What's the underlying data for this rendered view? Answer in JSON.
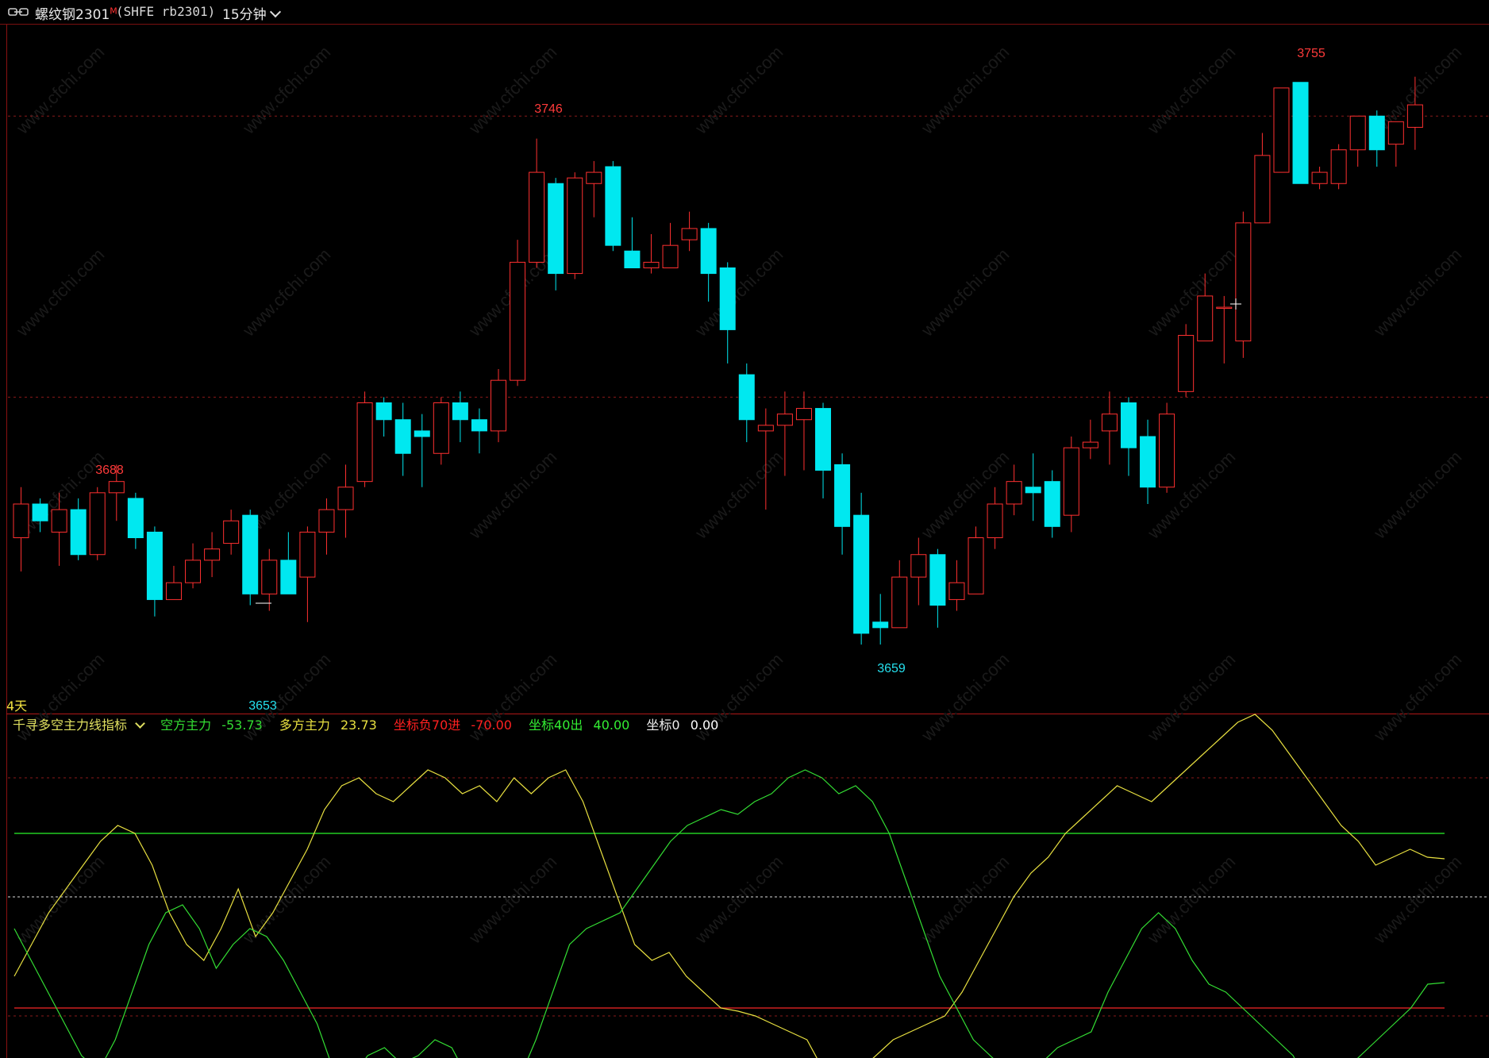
{
  "header": {
    "title": "螺纹钢2301",
    "superscript": "M",
    "code": "(SHFE rb2301)",
    "period": "15分钟"
  },
  "price_labels": {
    "high1": "3688",
    "high2": "3746",
    "high3": "3755",
    "low1": "3653",
    "low2": "3659"
  },
  "days_label": "4天",
  "indicator": {
    "name": "千寻多空主力线指标",
    "items": [
      {
        "label": "空方主力",
        "value": "-53.73",
        "color": "#33dd33"
      },
      {
        "label": "多方主力",
        "value": "23.73",
        "color": "#e8e040"
      },
      {
        "label": "坐标负70进",
        "value": "-70.00",
        "color": "#ff2020"
      },
      {
        "label": "坐标40出",
        "value": "40.00",
        "color": "#33ee33"
      },
      {
        "label": "坐标0",
        "value": "0.00",
        "color": "#ffffff"
      }
    ]
  },
  "watermark": "www.cfchi.com",
  "colors": {
    "up": "#ff3030",
    "down": "#00e8f0",
    "bull_line": "#e8e040",
    "bear_line": "#33dd33"
  },
  "chart_data": [
    {
      "type": "candlestick",
      "ylim": [
        3645,
        3765
      ],
      "candles": [
        [
          3675,
          3681,
          3669,
          3684
        ],
        [
          3681,
          3678,
          3676,
          3682
        ],
        [
          3676,
          3680,
          3670,
          3683
        ],
        [
          3680,
          3672,
          3671,
          3682
        ],
        [
          3672,
          3683,
          3671,
          3684
        ],
        [
          3683,
          3685,
          3678,
          3688
        ],
        [
          3682,
          3675,
          3673,
          3683
        ],
        [
          3676,
          3664,
          3661,
          3677
        ],
        [
          3664,
          3667,
          3664,
          3670
        ],
        [
          3667,
          3671,
          3666,
          3674
        ],
        [
          3671,
          3673,
          3668,
          3676
        ],
        [
          3674,
          3678,
          3672,
          3680
        ],
        [
          3679,
          3665,
          3663,
          3680
        ],
        [
          3665,
          3671,
          3662,
          3673
        ],
        [
          3671,
          3665,
          3665,
          3676
        ],
        [
          3668,
          3676,
          3660,
          3677
        ],
        [
          3676,
          3680,
          3672,
          3682
        ],
        [
          3680,
          3684,
          3675,
          3688
        ],
        [
          3685,
          3699,
          3684,
          3701
        ],
        [
          3699,
          3696,
          3693,
          3700
        ],
        [
          3696,
          3690,
          3686,
          3699
        ],
        [
          3694,
          3693,
          3684,
          3697
        ],
        [
          3690,
          3699,
          3688,
          3700
        ],
        [
          3699,
          3696,
          3692,
          3701
        ],
        [
          3696,
          3694,
          3690,
          3698
        ],
        [
          3694,
          3703,
          3692,
          3705
        ],
        [
          3703,
          3724,
          3702,
          3728
        ],
        [
          3724,
          3740,
          3723,
          3746
        ],
        [
          3738,
          3722,
          3719,
          3739
        ],
        [
          3722,
          3739,
          3721,
          3740
        ],
        [
          3738,
          3740,
          3732,
          3742
        ],
        [
          3741,
          3727,
          3726,
          3742
        ],
        [
          3726,
          3723,
          3723,
          3732
        ],
        [
          3723,
          3724,
          3722,
          3729
        ],
        [
          3723,
          3727,
          3724,
          3731
        ],
        [
          3728,
          3730,
          3726,
          3733
        ],
        [
          3730,
          3722,
          3717,
          3731
        ],
        [
          3723,
          3712,
          3706,
          3724
        ],
        [
          3704,
          3696,
          3692,
          3706
        ],
        [
          3694,
          3695,
          3680,
          3698
        ],
        [
          3695,
          3697,
          3686,
          3701
        ],
        [
          3696,
          3698,
          3687,
          3701
        ],
        [
          3698,
          3687,
          3682,
          3699
        ],
        [
          3688,
          3677,
          3672,
          3690
        ],
        [
          3679,
          3658,
          3656,
          3683
        ],
        [
          3660,
          3659,
          3656,
          3665
        ],
        [
          3659,
          3668,
          3659,
          3671
        ],
        [
          3668,
          3672,
          3663,
          3675
        ],
        [
          3672,
          3663,
          3659,
          3673
        ],
        [
          3664,
          3667,
          3662,
          3671
        ],
        [
          3665,
          3675,
          3665,
          3677
        ],
        [
          3675,
          3681,
          3673,
          3684
        ],
        [
          3681,
          3685,
          3679,
          3688
        ],
        [
          3684,
          3683,
          3678,
          3690
        ],
        [
          3685,
          3677,
          3675,
          3687
        ],
        [
          3679,
          3691,
          3676,
          3693
        ],
        [
          3691,
          3692,
          3689,
          3696
        ],
        [
          3694,
          3697,
          3688,
          3701
        ],
        [
          3699,
          3691,
          3686,
          3700
        ],
        [
          3693,
          3684,
          3681,
          3696
        ],
        [
          3684,
          3697,
          3683,
          3699
        ],
        [
          3701,
          3711,
          3700,
          3713
        ],
        [
          3710,
          3718,
          3713,
          3722
        ],
        [
          3716,
          3716,
          3706,
          3718
        ],
        [
          3710,
          3731,
          3707,
          3733
        ],
        [
          3731,
          3743,
          3733,
          3747
        ],
        [
          3740,
          3755,
          3740,
          3755
        ],
        [
          3756,
          3738,
          3738,
          3756
        ],
        [
          3738,
          3740,
          3737,
          3741
        ],
        [
          3738,
          3744,
          3737,
          3745
        ],
        [
          3744,
          3750,
          3741,
          3750
        ],
        [
          3750,
          3744,
          3741,
          3751
        ],
        [
          3745,
          3749,
          3741,
          3749
        ],
        [
          3748,
          3752,
          3744,
          3757
        ]
      ]
    },
    {
      "type": "line",
      "ylim": [
        -100,
        100
      ],
      "series": [
        {
          "name": "多方主力",
          "values": [
            -50,
            -30,
            -10,
            5,
            20,
            35,
            45,
            40,
            20,
            -10,
            -30,
            -40,
            -20,
            5,
            -25,
            -10,
            10,
            30,
            55,
            70,
            75,
            65,
            60,
            70,
            80,
            75,
            65,
            70,
            60,
            75,
            65,
            75,
            80,
            60,
            30,
            0,
            -30,
            -40,
            -35,
            -50,
            -60,
            -70,
            -72,
            -75,
            -80,
            -85,
            -90,
            -110,
            -115,
            -110,
            -100,
            -90,
            -85,
            -80,
            -75,
            -60,
            -40,
            -20,
            0,
            15,
            25,
            40,
            50,
            60,
            70,
            65,
            60,
            70,
            80,
            90,
            100,
            110,
            115,
            105,
            90,
            75,
            60,
            45,
            35,
            20,
            25,
            30,
            25,
            24
          ]
        },
        {
          "name": "空方主力",
          "values": [
            -20,
            -40,
            -60,
            -80,
            -100,
            -110,
            -90,
            -60,
            -30,
            -10,
            -5,
            -20,
            -45,
            -30,
            -20,
            -25,
            -40,
            -60,
            -80,
            -110,
            -115,
            -100,
            -95,
            -105,
            -100,
            -90,
            -95,
            -115,
            -110,
            -105,
            -115,
            -90,
            -60,
            -30,
            -20,
            -15,
            -10,
            5,
            20,
            35,
            45,
            50,
            55,
            52,
            60,
            65,
            75,
            80,
            75,
            65,
            70,
            60,
            40,
            10,
            -20,
            -50,
            -70,
            -90,
            -100,
            -110,
            -115,
            -105,
            -95,
            -90,
            -85,
            -60,
            -40,
            -20,
            -10,
            -20,
            -40,
            -55,
            -60,
            -70,
            -80,
            -90,
            -100,
            -120,
            -115,
            -110,
            -100,
            -90,
            -80,
            -70,
            -55,
            -54
          ]
        }
      ]
    }
  ]
}
